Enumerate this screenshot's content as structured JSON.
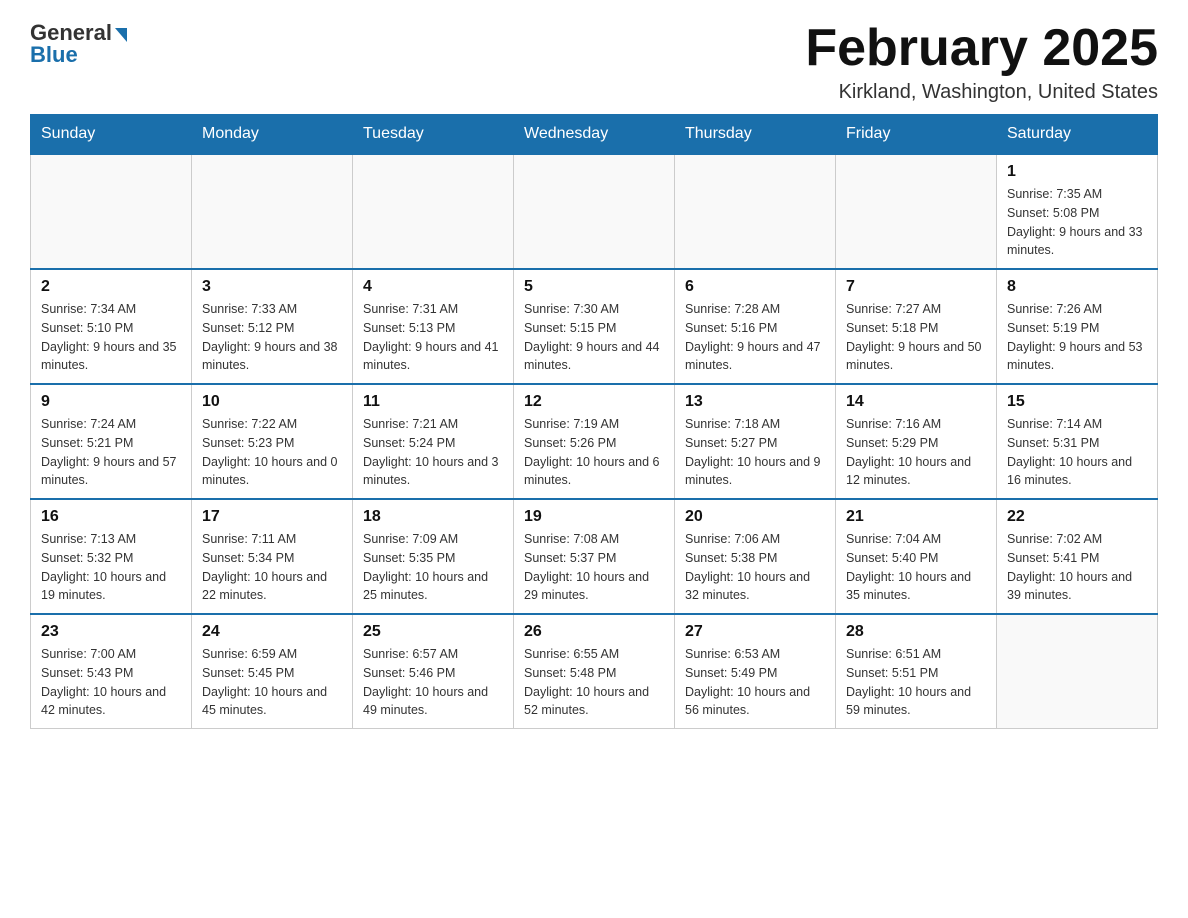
{
  "header": {
    "logo_general": "General",
    "logo_blue": "Blue",
    "main_title": "February 2025",
    "subtitle": "Kirkland, Washington, United States"
  },
  "days_of_week": [
    "Sunday",
    "Monday",
    "Tuesday",
    "Wednesday",
    "Thursday",
    "Friday",
    "Saturday"
  ],
  "weeks": [
    {
      "days": [
        {
          "num": "",
          "info": ""
        },
        {
          "num": "",
          "info": ""
        },
        {
          "num": "",
          "info": ""
        },
        {
          "num": "",
          "info": ""
        },
        {
          "num": "",
          "info": ""
        },
        {
          "num": "",
          "info": ""
        },
        {
          "num": "1",
          "info": "Sunrise: 7:35 AM\nSunset: 5:08 PM\nDaylight: 9 hours and 33 minutes."
        }
      ]
    },
    {
      "days": [
        {
          "num": "2",
          "info": "Sunrise: 7:34 AM\nSunset: 5:10 PM\nDaylight: 9 hours and 35 minutes."
        },
        {
          "num": "3",
          "info": "Sunrise: 7:33 AM\nSunset: 5:12 PM\nDaylight: 9 hours and 38 minutes."
        },
        {
          "num": "4",
          "info": "Sunrise: 7:31 AM\nSunset: 5:13 PM\nDaylight: 9 hours and 41 minutes."
        },
        {
          "num": "5",
          "info": "Sunrise: 7:30 AM\nSunset: 5:15 PM\nDaylight: 9 hours and 44 minutes."
        },
        {
          "num": "6",
          "info": "Sunrise: 7:28 AM\nSunset: 5:16 PM\nDaylight: 9 hours and 47 minutes."
        },
        {
          "num": "7",
          "info": "Sunrise: 7:27 AM\nSunset: 5:18 PM\nDaylight: 9 hours and 50 minutes."
        },
        {
          "num": "8",
          "info": "Sunrise: 7:26 AM\nSunset: 5:19 PM\nDaylight: 9 hours and 53 minutes."
        }
      ]
    },
    {
      "days": [
        {
          "num": "9",
          "info": "Sunrise: 7:24 AM\nSunset: 5:21 PM\nDaylight: 9 hours and 57 minutes."
        },
        {
          "num": "10",
          "info": "Sunrise: 7:22 AM\nSunset: 5:23 PM\nDaylight: 10 hours and 0 minutes."
        },
        {
          "num": "11",
          "info": "Sunrise: 7:21 AM\nSunset: 5:24 PM\nDaylight: 10 hours and 3 minutes."
        },
        {
          "num": "12",
          "info": "Sunrise: 7:19 AM\nSunset: 5:26 PM\nDaylight: 10 hours and 6 minutes."
        },
        {
          "num": "13",
          "info": "Sunrise: 7:18 AM\nSunset: 5:27 PM\nDaylight: 10 hours and 9 minutes."
        },
        {
          "num": "14",
          "info": "Sunrise: 7:16 AM\nSunset: 5:29 PM\nDaylight: 10 hours and 12 minutes."
        },
        {
          "num": "15",
          "info": "Sunrise: 7:14 AM\nSunset: 5:31 PM\nDaylight: 10 hours and 16 minutes."
        }
      ]
    },
    {
      "days": [
        {
          "num": "16",
          "info": "Sunrise: 7:13 AM\nSunset: 5:32 PM\nDaylight: 10 hours and 19 minutes."
        },
        {
          "num": "17",
          "info": "Sunrise: 7:11 AM\nSunset: 5:34 PM\nDaylight: 10 hours and 22 minutes."
        },
        {
          "num": "18",
          "info": "Sunrise: 7:09 AM\nSunset: 5:35 PM\nDaylight: 10 hours and 25 minutes."
        },
        {
          "num": "19",
          "info": "Sunrise: 7:08 AM\nSunset: 5:37 PM\nDaylight: 10 hours and 29 minutes."
        },
        {
          "num": "20",
          "info": "Sunrise: 7:06 AM\nSunset: 5:38 PM\nDaylight: 10 hours and 32 minutes."
        },
        {
          "num": "21",
          "info": "Sunrise: 7:04 AM\nSunset: 5:40 PM\nDaylight: 10 hours and 35 minutes."
        },
        {
          "num": "22",
          "info": "Sunrise: 7:02 AM\nSunset: 5:41 PM\nDaylight: 10 hours and 39 minutes."
        }
      ]
    },
    {
      "days": [
        {
          "num": "23",
          "info": "Sunrise: 7:00 AM\nSunset: 5:43 PM\nDaylight: 10 hours and 42 minutes."
        },
        {
          "num": "24",
          "info": "Sunrise: 6:59 AM\nSunset: 5:45 PM\nDaylight: 10 hours and 45 minutes."
        },
        {
          "num": "25",
          "info": "Sunrise: 6:57 AM\nSunset: 5:46 PM\nDaylight: 10 hours and 49 minutes."
        },
        {
          "num": "26",
          "info": "Sunrise: 6:55 AM\nSunset: 5:48 PM\nDaylight: 10 hours and 52 minutes."
        },
        {
          "num": "27",
          "info": "Sunrise: 6:53 AM\nSunset: 5:49 PM\nDaylight: 10 hours and 56 minutes."
        },
        {
          "num": "28",
          "info": "Sunrise: 6:51 AM\nSunset: 5:51 PM\nDaylight: 10 hours and 59 minutes."
        },
        {
          "num": "",
          "info": ""
        }
      ]
    }
  ]
}
